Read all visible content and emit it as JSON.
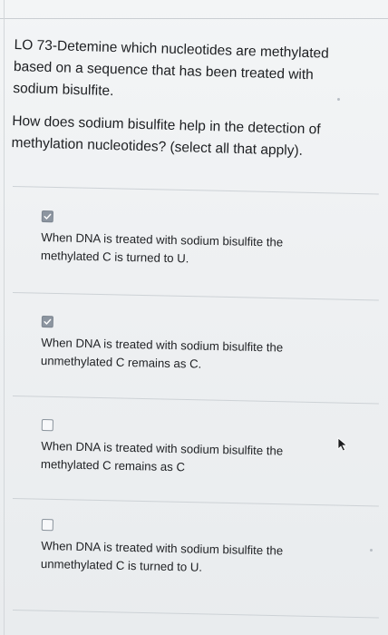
{
  "question": {
    "title": "LO 73-Detemine which nucleotides are methylated\nbased on a sequence that has been treated with\nsodium bisulfite.",
    "prompt": "How does sodium bisulfite help in the detection of\nmethylation nucleotides? (select all that apply)."
  },
  "options": [
    {
      "text": "When DNA is treated with sodium bisulfite the\nmethylated C is turned to U.",
      "checked": true
    },
    {
      "text": "When DNA is treated with sodium bisulfite the\nunmethylated C remains as C.",
      "checked": true
    },
    {
      "text": "When DNA is treated with sodium bisulfite the\nmethylated C remains as C",
      "checked": false
    },
    {
      "text": "When DNA is treated with sodium bisulfite the\nunmethylated C is turned to U.",
      "checked": false
    }
  ],
  "colors": {
    "checked_fill": "#8c95a0",
    "unchecked_fill": "#f7f8fa",
    "text": "#1d1f22"
  },
  "icons": {
    "checked": "check-icon",
    "cursor": "mouse-pointer-icon"
  }
}
